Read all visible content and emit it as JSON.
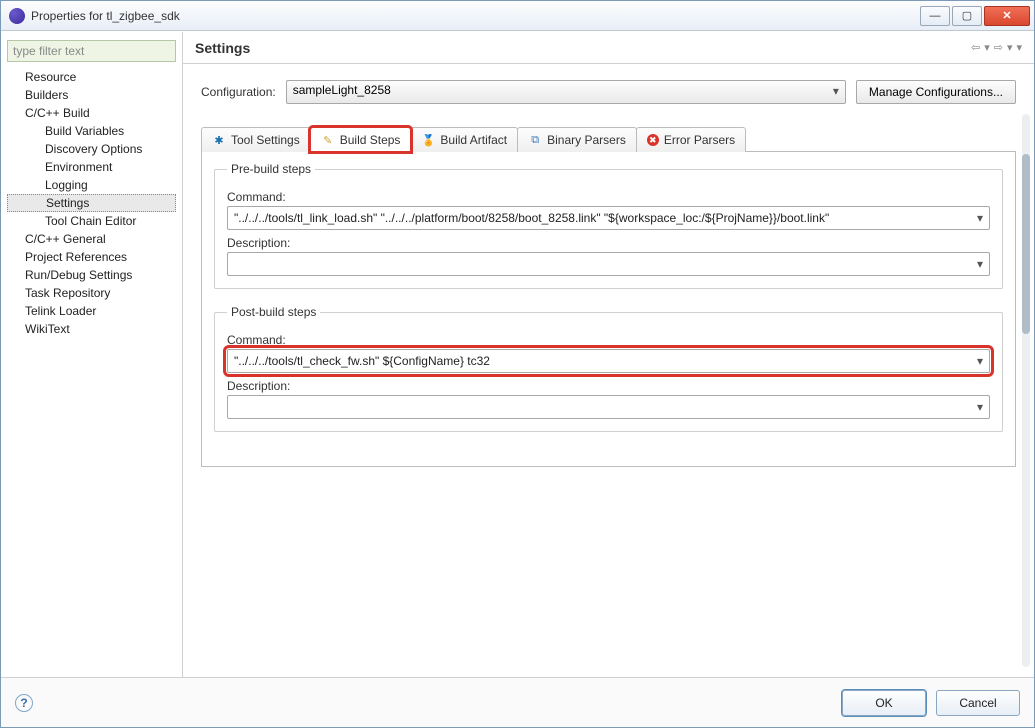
{
  "window": {
    "title": "Properties for tl_zigbee_sdk"
  },
  "sidebar": {
    "filter_placeholder": "type filter text",
    "items": [
      {
        "label": "Resource",
        "level": 1
      },
      {
        "label": "Builders",
        "level": 1
      },
      {
        "label": "C/C++ Build",
        "level": 1
      },
      {
        "label": "Build Variables",
        "level": 2
      },
      {
        "label": "Discovery Options",
        "level": 2
      },
      {
        "label": "Environment",
        "level": 2
      },
      {
        "label": "Logging",
        "level": 2
      },
      {
        "label": "Settings",
        "level": 2,
        "selected": true
      },
      {
        "label": "Tool Chain Editor",
        "level": 2
      },
      {
        "label": "C/C++ General",
        "level": 1
      },
      {
        "label": "Project References",
        "level": 1
      },
      {
        "label": "Run/Debug Settings",
        "level": 1
      },
      {
        "label": "Task Repository",
        "level": 1
      },
      {
        "label": "Telink Loader",
        "level": 1
      },
      {
        "label": "WikiText",
        "level": 1
      }
    ]
  },
  "main": {
    "heading": "Settings",
    "configuration_label": "Configuration:",
    "configuration_value": "sampleLight_8258",
    "manage_button": "Manage Configurations...",
    "tabs": {
      "tool_settings": "Tool Settings",
      "build_steps": "Build Steps",
      "build_artifact": "Build Artifact",
      "binary_parsers": "Binary Parsers",
      "error_parsers": "Error Parsers"
    },
    "pre_build": {
      "legend": "Pre-build steps",
      "command_label": "Command:",
      "command_value": "\"../../../tools/tl_link_load.sh\" \"../../../platform/boot/8258/boot_8258.link\" \"${workspace_loc:/${ProjName}}/boot.link\"",
      "description_label": "Description:",
      "description_value": ""
    },
    "post_build": {
      "legend": "Post-build steps",
      "command_label": "Command:",
      "command_value": "\"../../../tools/tl_check_fw.sh\" ${ConfigName} tc32",
      "description_label": "Description:",
      "description_value": ""
    }
  },
  "footer": {
    "ok": "OK",
    "cancel": "Cancel"
  },
  "highlight": {
    "tab": "build_steps",
    "field": "post_build_command"
  }
}
